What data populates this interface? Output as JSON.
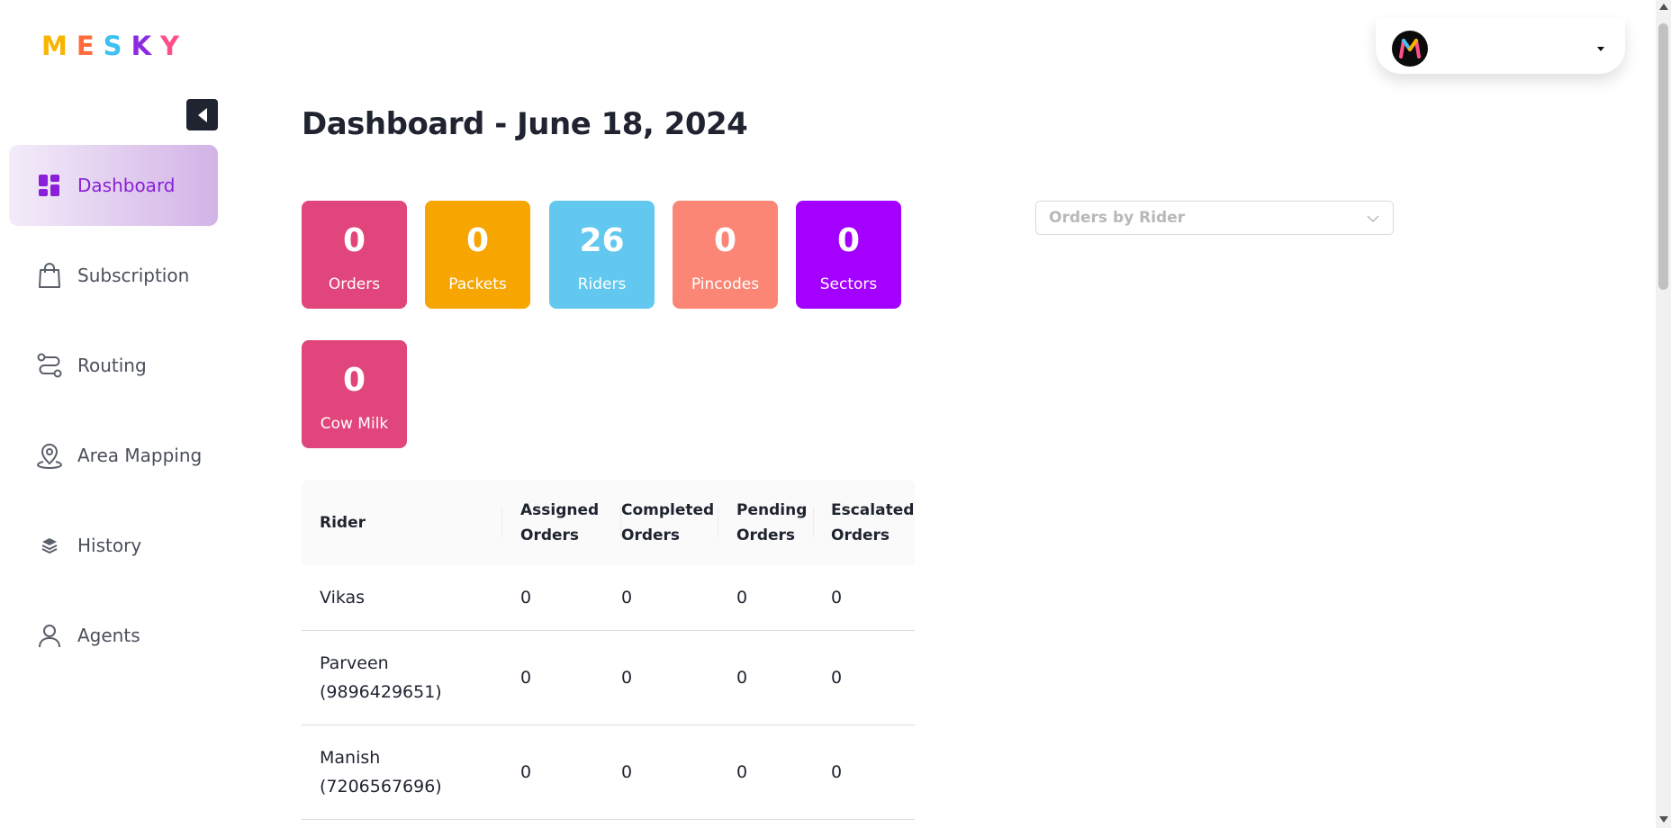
{
  "logo": {
    "letters": [
      "M",
      "E",
      "S",
      "K",
      "Y"
    ],
    "colors": [
      "#f7b500",
      "#ff6b3d",
      "#3ec1f0",
      "#8a2be2",
      "#ff4f8b"
    ]
  },
  "sidebar": {
    "items": [
      {
        "label": "Dashboard",
        "icon": "dashboard-icon",
        "active": true
      },
      {
        "label": "Subscription",
        "icon": "shopping-bag-icon",
        "active": false
      },
      {
        "label": "Routing",
        "icon": "route-icon",
        "active": false
      },
      {
        "label": "Area Mapping",
        "icon": "map-pin-icon",
        "active": false
      },
      {
        "label": "History",
        "icon": "layers-icon",
        "active": false
      },
      {
        "label": "Agents",
        "icon": "user-icon",
        "active": false
      }
    ]
  },
  "header": {
    "avatar_letter": "M"
  },
  "page": {
    "title": "Dashboard - June 18, 2024"
  },
  "stats": [
    {
      "value": "0",
      "label": "Orders",
      "color": "#e0457b"
    },
    {
      "value": "0",
      "label": "Packets",
      "color": "#f7a500"
    },
    {
      "value": "26",
      "label": "Riders",
      "color": "#62c8ef"
    },
    {
      "value": "0",
      "label": "Pincodes",
      "color": "#fb8676"
    },
    {
      "value": "0",
      "label": "Sectors",
      "color": "#a400ff"
    },
    {
      "value": "0",
      "label": "Cow Milk",
      "color": "#e0457b"
    }
  ],
  "orders_by_rider": {
    "placeholder": "Orders by Rider"
  },
  "table": {
    "columns": [
      "Rider",
      "Assigned Orders",
      "Completed Orders",
      "Pending Orders",
      "Escalated Orders"
    ],
    "rows": [
      {
        "rider": "Vikas",
        "assigned": "0",
        "completed": "0",
        "pending": "0",
        "escalated": "0"
      },
      {
        "rider": "Parveen (9896429651)",
        "assigned": "0",
        "completed": "0",
        "pending": "0",
        "escalated": "0"
      },
      {
        "rider": "Manish (7206567696)",
        "assigned": "0",
        "completed": "0",
        "pending": "0",
        "escalated": "0"
      }
    ]
  },
  "colors": {
    "accent": "#8a1fd9",
    "dark": "#1f2430"
  }
}
